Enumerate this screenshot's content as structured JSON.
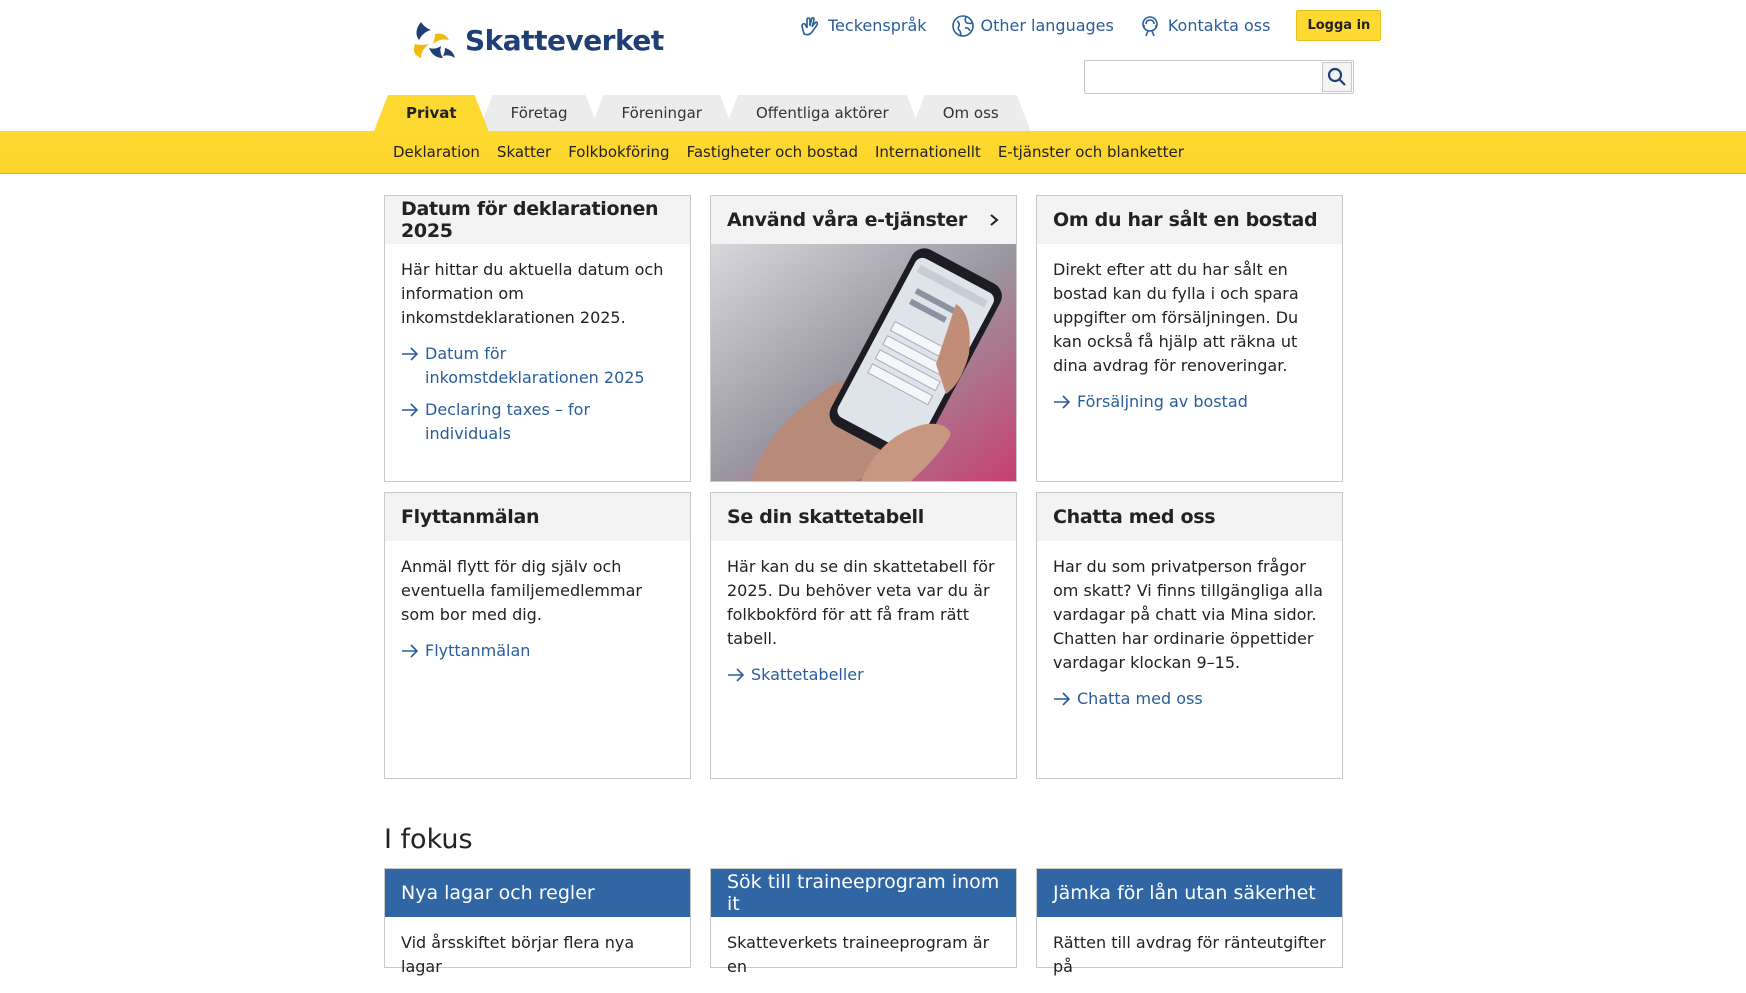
{
  "brand": {
    "name": "Skatteverket",
    "accent": "#fed931",
    "link": "#2a5d99",
    "fokus_header": "#2f66a3"
  },
  "topnav": {
    "sign_language": {
      "label": "Teckenspråk",
      "icon": "hands-icon"
    },
    "other_languages": {
      "label": "Other languages",
      "icon": "globe-icon"
    },
    "contact": {
      "label": "Kontakta oss",
      "icon": "support-icon"
    },
    "login": "Logga in"
  },
  "search": {
    "placeholder": "",
    "icon": "search-icon"
  },
  "tabs": [
    {
      "label": "Privat",
      "active": true
    },
    {
      "label": "Företag",
      "active": false
    },
    {
      "label": "Föreningar",
      "active": false
    },
    {
      "label": "Offentliga aktörer",
      "active": false
    },
    {
      "label": "Om oss",
      "active": false
    }
  ],
  "subnav": [
    "Deklaration",
    "Skatter",
    "Folkbokföring",
    "Fastigheter och bostad",
    "Internationellt",
    "E-tjänster och blanketter"
  ],
  "cards": [
    {
      "title": "Datum för deklarationen 2025",
      "text": "Här hittar du aktuella datum och information om inkomstdeklarationen 2025.",
      "links": [
        "Datum för inkomstdeklarationen 2025",
        "Declaring taxes – for individuals"
      ]
    },
    {
      "title": "Använd våra e-tjänster",
      "image": "Hand holding phone showing Skatteverket login"
    },
    {
      "title": "Om du har sålt en bostad",
      "text": "Direkt efter att du har sålt en bostad kan du fylla i och spara uppgifter om försäljningen. Du kan också få hjälp att räkna ut dina avdrag för renoveringar.",
      "links": [
        "Försäljning av bostad"
      ]
    },
    {
      "title": "Flyttanmälan",
      "text": "Anmäl flytt för dig själv och eventuella familjemedlemmar som bor med dig.",
      "links": [
        "Flyttanmälan"
      ]
    },
    {
      "title": "Se din skattetabell",
      "text": "Här kan du se din skattetabell för 2025. Du behöver veta var du är folkbokförd för att få fram rätt tabell.",
      "links": [
        "Skattetabeller"
      ]
    },
    {
      "title": "Chatta med oss",
      "text": "Har du som privatperson frågor om skatt? Vi finns tillgängliga alla vardagar på chatt via Mina sidor. Chatten har ordinarie öppettider vardagar klockan 9–15.",
      "links": [
        "Chatta med oss"
      ]
    }
  ],
  "fokus": {
    "title": "I fokus",
    "cards": [
      {
        "title": "Nya lagar och regler",
        "text": "Vid årsskiftet börjar flera nya lagar"
      },
      {
        "title": "Sök till traineeprogram inom it",
        "text": "Skatteverkets traineeprogram är en"
      },
      {
        "title": "Jämka för lån utan säkerhet",
        "text": "Rätten till avdrag för ränteutgifter på"
      }
    ]
  }
}
